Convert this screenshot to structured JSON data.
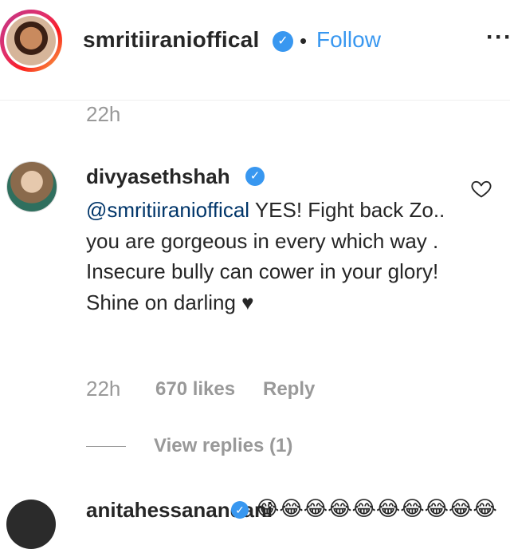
{
  "header": {
    "username": "smritiiranioffical",
    "separator": "•",
    "follow_label": "Follow",
    "more_label": "···"
  },
  "previous_comment": {
    "time": "22h"
  },
  "comment": {
    "username": "divyasethshah",
    "mention": "@smritiiranioffical",
    "text": " YES! Fight back Zo.. you are gorgeous in every which way . Insecure bully can cower in your glory! Shine on darling ♥",
    "time": "22h",
    "likes": "670 likes",
    "reply_label": "Reply",
    "view_replies_label": "View replies (1)"
  },
  "next_comment": {
    "username": "anitahessanandani",
    "text": "😂😂😂😂😂😂😂😂😂😂"
  },
  "colors": {
    "accent": "#3897f0",
    "muted": "#999999",
    "mention": "#003569"
  }
}
